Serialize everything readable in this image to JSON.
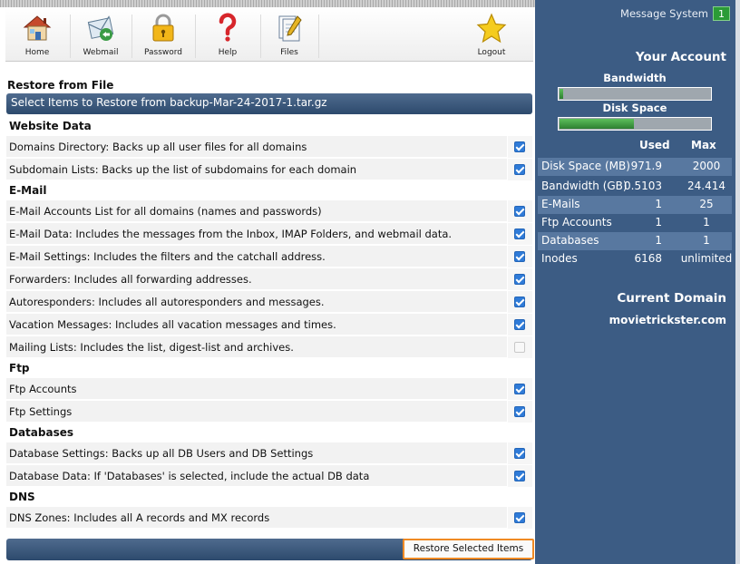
{
  "nav": {
    "items": [
      {
        "label": "Home",
        "icon": "house-icon"
      },
      {
        "label": "Webmail",
        "icon": "envelope-icon"
      },
      {
        "label": "Password",
        "icon": "padlock-icon"
      },
      {
        "label": "Help",
        "icon": "question-mark-icon"
      },
      {
        "label": "Files",
        "icon": "file-pen-icon"
      },
      {
        "label": "Logout",
        "icon": "star-icon"
      }
    ]
  },
  "restore": {
    "heading": "Restore from File",
    "bar_title": "Select Items to Restore from backup-Mar-24-2017-1.tar.gz",
    "button_label": "Restore Selected Items",
    "groups": [
      {
        "label": "Website Data",
        "items": [
          {
            "text": "Domains Directory: Backs up all user files for all domains",
            "checked": true
          },
          {
            "text": "Subdomain Lists: Backs up the list of subdomains for each domain",
            "checked": true
          }
        ]
      },
      {
        "label": "E-Mail",
        "items": [
          {
            "text": "E-Mail Accounts List for all domains (names and passwords)",
            "checked": true
          },
          {
            "text": "E-Mail Data: Includes the messages from the Inbox, IMAP Folders, and webmail data.",
            "checked": true
          },
          {
            "text": "E-Mail Settings: Includes the filters and the catchall address.",
            "checked": true
          },
          {
            "text": "Forwarders: Includes all forwarding addresses.",
            "checked": true
          },
          {
            "text": "Autoresponders: Includes all autoresponders and messages.",
            "checked": true
          },
          {
            "text": "Vacation Messages: Includes all vacation messages and times.",
            "checked": true
          },
          {
            "text": "Mailing Lists: Includes the list, digest-list and archives.",
            "checked": false
          }
        ]
      },
      {
        "label": "Ftp",
        "items": [
          {
            "text": "Ftp Accounts",
            "checked": true
          },
          {
            "text": "Ftp Settings",
            "checked": true
          }
        ]
      },
      {
        "label": "Databases",
        "items": [
          {
            "text": "Database Settings: Backs up all DB Users and DB Settings",
            "checked": true
          },
          {
            "text": "Database Data: If 'Databases' is selected, include the actual DB data",
            "checked": true
          }
        ]
      },
      {
        "label": "DNS",
        "items": [
          {
            "text": "DNS Zones: Includes all A records and MX records",
            "checked": true
          }
        ]
      }
    ]
  },
  "sidebar": {
    "message_system_label": "Message System",
    "message_count": "1",
    "your_account": "Your Account",
    "bandwidth_label": "Bandwidth",
    "bandwidth_fraction": 0.021,
    "disk_label": "Disk Space",
    "disk_fraction": 0.486,
    "col_used": "Used",
    "col_max": "Max",
    "stats": [
      {
        "name": "Disk Space (MB)",
        "used": "971.9",
        "max": "2000"
      },
      {
        "name": "Bandwidth (GB)",
        "used": "0.5103",
        "max": "24.414"
      },
      {
        "name": "E-Mails",
        "used": "1",
        "max": "25"
      },
      {
        "name": "Ftp Accounts",
        "used": "1",
        "max": "1"
      },
      {
        "name": "Databases",
        "used": "1",
        "max": "1"
      },
      {
        "name": "Inodes",
        "used": "6168",
        "max": "unlimited"
      }
    ],
    "current_domain_label": "Current Domain",
    "domain": "movietrickster.com"
  },
  "colors": {
    "sidebar_bg": "#3c5c84",
    "bar_blue": "#2d4a6d",
    "checkbox_blue": "#2f7bd8",
    "button_highlight": "#f08a24",
    "badge_green": "#2b9b36"
  }
}
